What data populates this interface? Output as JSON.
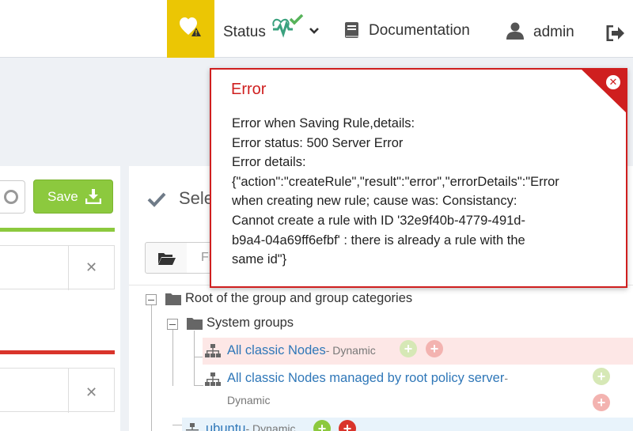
{
  "navbar": {
    "status_label": "Status",
    "documentation_label": "Documentation",
    "user_label": "admin",
    "health_color": "#ebc604"
  },
  "left_panel": {
    "save_label": "Save"
  },
  "right_panel": {
    "header_partial": "Sele",
    "filter_placeholder_partial": "Fi"
  },
  "tree": {
    "root_label": "Root of the group and group categories",
    "system_groups_label": "System groups",
    "item1_label": "All classic Nodes",
    "item1_kind": "- Dynamic",
    "item2_label": "All classic Nodes managed by root policy server",
    "item2_dash": "-",
    "item2_kind": "Dynamic",
    "item3_label": "ubuntu",
    "item3_kind": "- Dynamic"
  },
  "error": {
    "title": "Error",
    "lines": [
      "Error when Saving Rule,details:",
      "Error status: 500 Server Error",
      "Error details:",
      "{\"action\":\"createRule\",\"result\":\"error\",\"errorDetails\":\"Error",
      "when creating new rule; cause was: Consistancy:",
      "Cannot create a rule with ID '32e9f40b-4779-491d-",
      "b9a4-04a69ff6efbf' : there is already a rule with the",
      "same id\"}"
    ],
    "accent_color": "#cf1f1f"
  },
  "icons": {
    "health": "heart-warning-icon",
    "status": "heartbeat-check-icon",
    "documentation": "book-icon",
    "user": "user-icon",
    "logout": "logout-icon",
    "save": "download-icon",
    "close": "close-icon"
  }
}
